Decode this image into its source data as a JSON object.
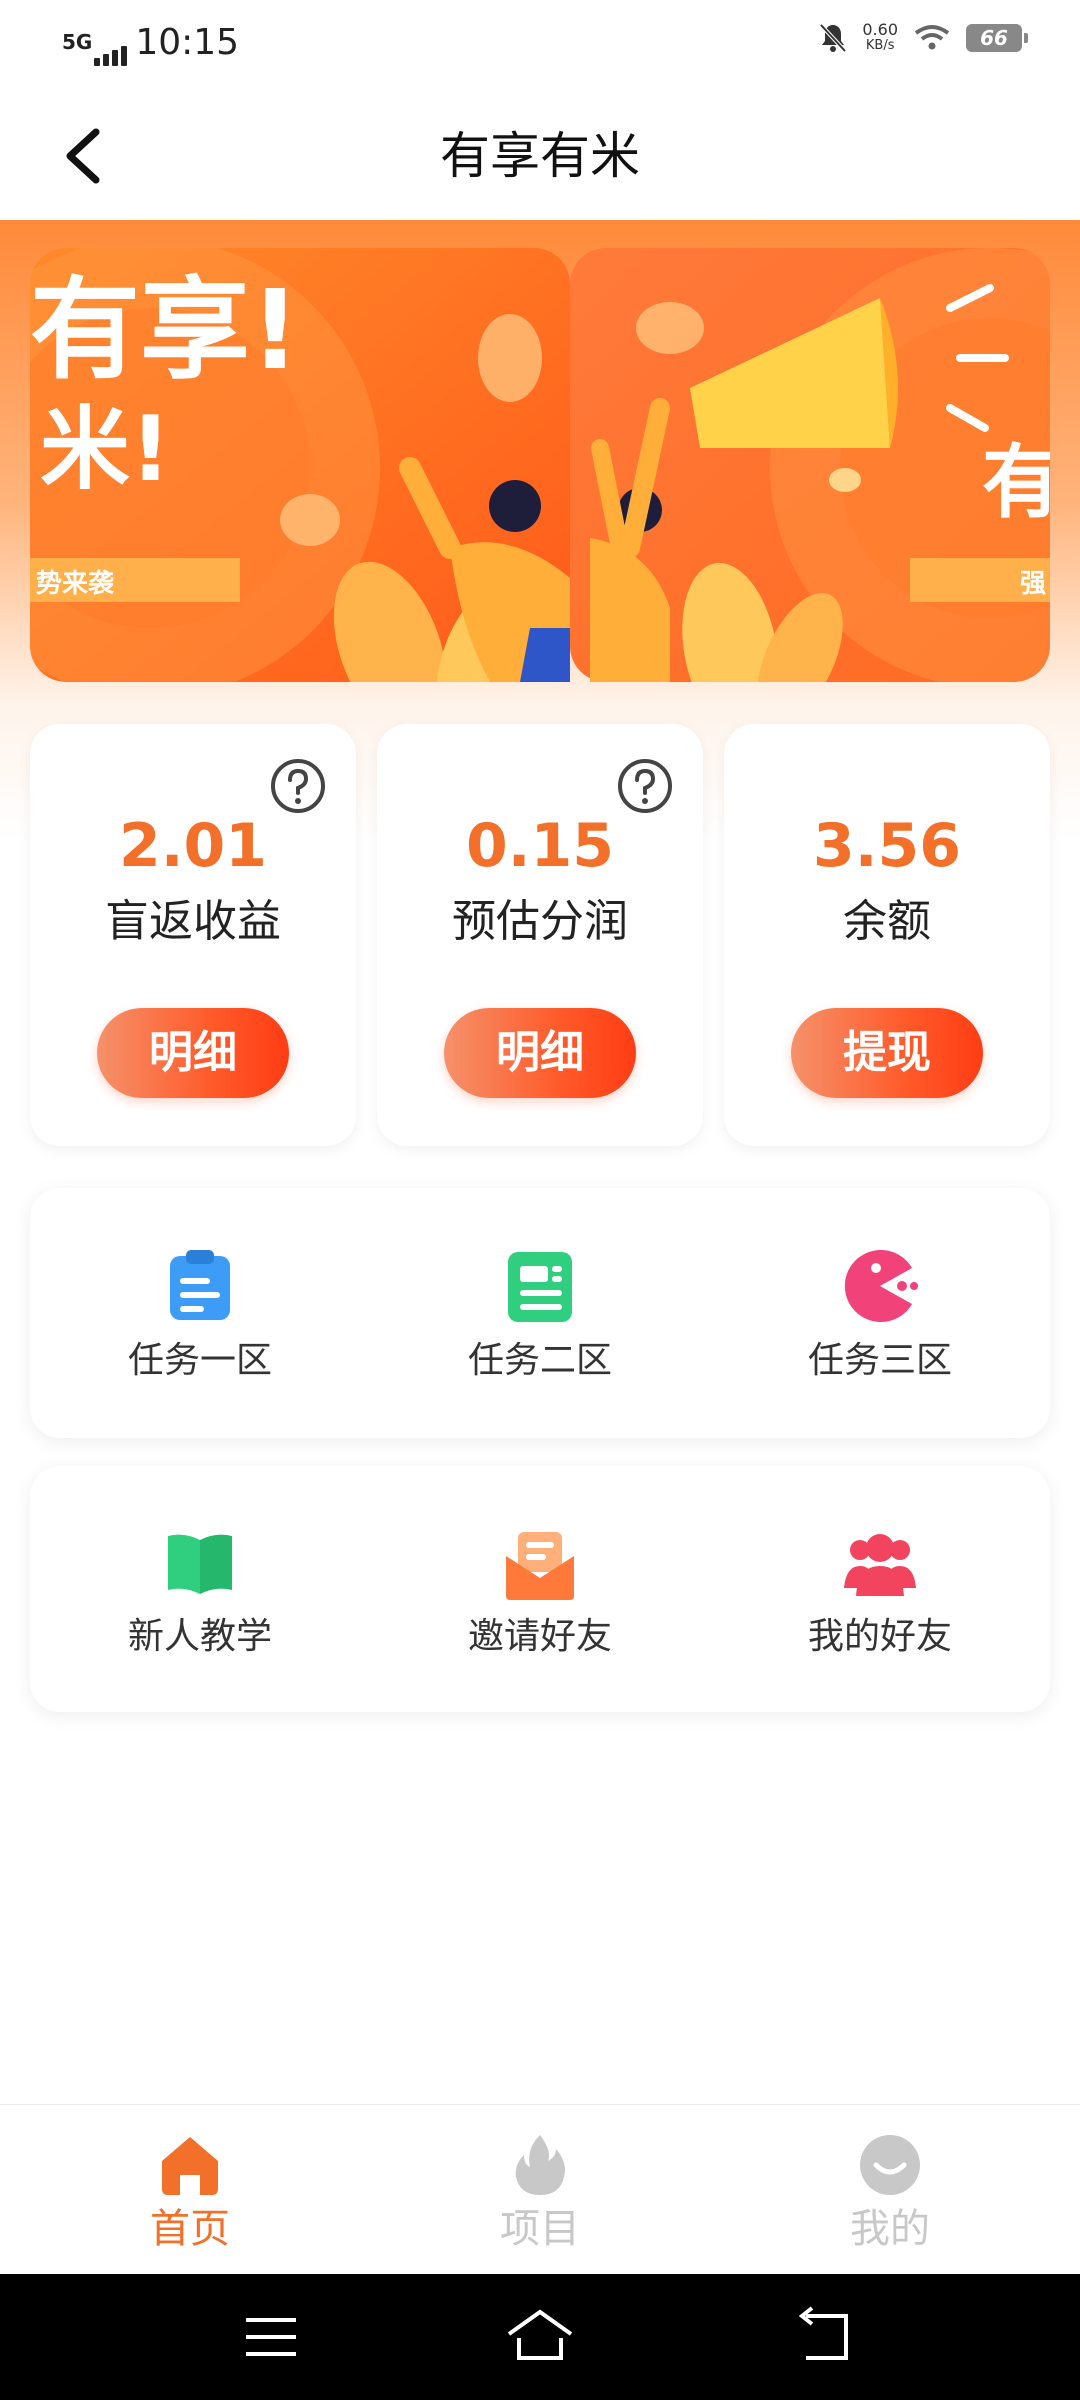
{
  "status_bar": {
    "network": "5G",
    "time": "10:15",
    "speed_value": "0.60",
    "speed_unit": "KB/s",
    "battery": "66"
  },
  "header": {
    "title": "有享有米",
    "back_icon": "chevron-left-icon"
  },
  "banner": {
    "left_slogan_1": "有享!",
    "left_slogan_2": "米!",
    "left_ribbon": "势来袭",
    "right_slogan": "有",
    "right_ribbon": "强"
  },
  "stats": [
    {
      "value": "2.01",
      "label": "盲返收益",
      "button": "明细",
      "has_help": true
    },
    {
      "value": "0.15",
      "label": "预估分润",
      "button": "明细",
      "has_help": true
    },
    {
      "value": "3.56",
      "label": "余额",
      "button": "提现",
      "has_help": false
    }
  ],
  "task_zones": [
    {
      "label": "任务一区",
      "icon": "clipboard-icon",
      "color": "#3d9df6"
    },
    {
      "label": "任务二区",
      "icon": "document-list-icon",
      "color": "#2fcf7f"
    },
    {
      "label": "任务三区",
      "icon": "pacman-icon",
      "color": "#f2427a"
    }
  ],
  "features": [
    {
      "label": "新人教学",
      "icon": "book-icon",
      "color": "#2fcf7f"
    },
    {
      "label": "邀请好友",
      "icon": "envelope-icon",
      "color": "#ff7a3a"
    },
    {
      "label": "我的好友",
      "icon": "users-icon",
      "color": "#f2445e"
    }
  ],
  "bottom_nav": [
    {
      "label": "首页",
      "icon": "home-icon",
      "active": true
    },
    {
      "label": "项目",
      "icon": "flame-icon",
      "active": false
    },
    {
      "label": "我的",
      "icon": "smile-icon",
      "active": false
    }
  ],
  "colors": {
    "accent": "#f2702a",
    "inactive": "#c8c8c8"
  }
}
